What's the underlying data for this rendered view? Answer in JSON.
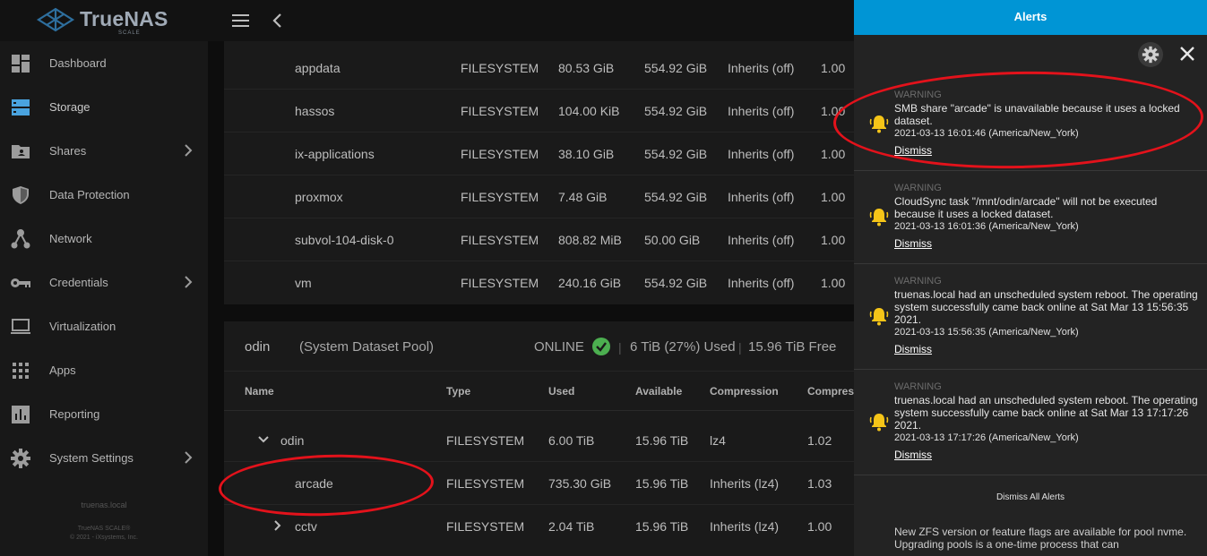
{
  "brand": {
    "name": "TrueNAS",
    "edition": "SCALE"
  },
  "sidebar": {
    "items": [
      {
        "label": "Dashboard",
        "icon": "dashboard-icon",
        "submenu": false
      },
      {
        "label": "Storage",
        "icon": "storage-icon",
        "submenu": false,
        "active": true
      },
      {
        "label": "Shares",
        "icon": "shares-icon",
        "submenu": true
      },
      {
        "label": "Data Protection",
        "icon": "shield-icon",
        "submenu": false
      },
      {
        "label": "Network",
        "icon": "network-icon",
        "submenu": false
      },
      {
        "label": "Credentials",
        "icon": "key-icon",
        "submenu": true
      },
      {
        "label": "Virtualization",
        "icon": "laptop-icon",
        "submenu": false
      },
      {
        "label": "Apps",
        "icon": "apps-grid-icon",
        "submenu": false
      },
      {
        "label": "Reporting",
        "icon": "reporting-icon",
        "submenu": false
      },
      {
        "label": "System Settings",
        "icon": "gear-icon",
        "submenu": true
      }
    ],
    "hostname": "truenas.local",
    "version": "TrueNAS SCALE®",
    "copyright": "© 2021 - iXsystems, Inc."
  },
  "pool1": {
    "rows": [
      {
        "name": "appdata",
        "type": "FILESYSTEM",
        "used": "80.53 GiB",
        "available": "554.92 GiB",
        "compression": "Inherits (off)",
        "ratio": "1.00"
      },
      {
        "name": "hassos",
        "type": "FILESYSTEM",
        "used": "104.00 KiB",
        "available": "554.92 GiB",
        "compression": "Inherits (off)",
        "ratio": "1.00"
      },
      {
        "name": "ix-applications",
        "type": "FILESYSTEM",
        "used": "38.10 GiB",
        "available": "554.92 GiB",
        "compression": "Inherits (off)",
        "ratio": "1.00"
      },
      {
        "name": "proxmox",
        "type": "FILESYSTEM",
        "used": "7.48 GiB",
        "available": "554.92 GiB",
        "compression": "Inherits (off)",
        "ratio": "1.00"
      },
      {
        "name": "subvol-104-disk-0",
        "type": "FILESYSTEM",
        "used": "808.82 MiB",
        "available": "50.00 GiB",
        "compression": "Inherits (off)",
        "ratio": "1.00"
      },
      {
        "name": "vm",
        "type": "FILESYSTEM",
        "used": "240.16 GiB",
        "available": "554.92 GiB",
        "compression": "Inherits (off)",
        "ratio": "1.00"
      }
    ]
  },
  "pool2": {
    "name": "odin",
    "subtitle": "(System Dataset Pool)",
    "status": "ONLINE",
    "used": "6 TiB (27%) Used",
    "free": "15.96 TiB Free",
    "columns": [
      "Name",
      "Type",
      "Used",
      "Available",
      "Compression",
      "Compress"
    ],
    "rows": [
      {
        "name": "odin",
        "type": "FILESYSTEM",
        "used": "6.00 TiB",
        "available": "15.96 TiB",
        "compression": "lz4",
        "ratio": "1.02"
      },
      {
        "name": "arcade",
        "type": "FILESYSTEM",
        "used": "735.30 GiB",
        "available": "15.96 TiB",
        "compression": "Inherits (lz4)",
        "ratio": "1.03"
      },
      {
        "name": "cctv",
        "type": "FILESYSTEM",
        "used": "2.04 TiB",
        "available": "15.96 TiB",
        "compression": "Inherits (lz4)",
        "ratio": "1.00"
      }
    ]
  },
  "alerts": {
    "title": "Alerts",
    "items": [
      {
        "level": "WARNING",
        "message": "SMB share \"arcade\" is unavailable because it uses a locked dataset.",
        "time": "2021-03-13 16:01:46 (America/New_York)",
        "dismiss": "Dismiss"
      },
      {
        "level": "WARNING",
        "message": "CloudSync task \"/mnt/odin/arcade\" will not be executed because it uses a locked dataset.",
        "time": "2021-03-13 16:01:36 (America/New_York)",
        "dismiss": "Dismiss"
      },
      {
        "level": "WARNING",
        "message": "truenas.local had an unscheduled system reboot. The operating system successfully came back online at Sat Mar 13 15:56:35 2021.",
        "time": "2021-03-13 15:56:35 (America/New_York)",
        "dismiss": "Dismiss"
      },
      {
        "level": "WARNING",
        "message": "truenas.local had an unscheduled system reboot. The operating system successfully came back online at Sat Mar 13 17:17:26 2021.",
        "time": "2021-03-13 17:17:26 (America/New_York)",
        "dismiss": "Dismiss"
      }
    ],
    "dismiss_all": "Dismiss All Alerts",
    "bottom_note": "New ZFS version or feature flags are available for pool nvme. Upgrading pools is a one-time process that can"
  },
  "colors": {
    "accent": "#0095d5",
    "warning": "#f5c518",
    "online": "#4caf50",
    "annotation": "#e3121b"
  }
}
